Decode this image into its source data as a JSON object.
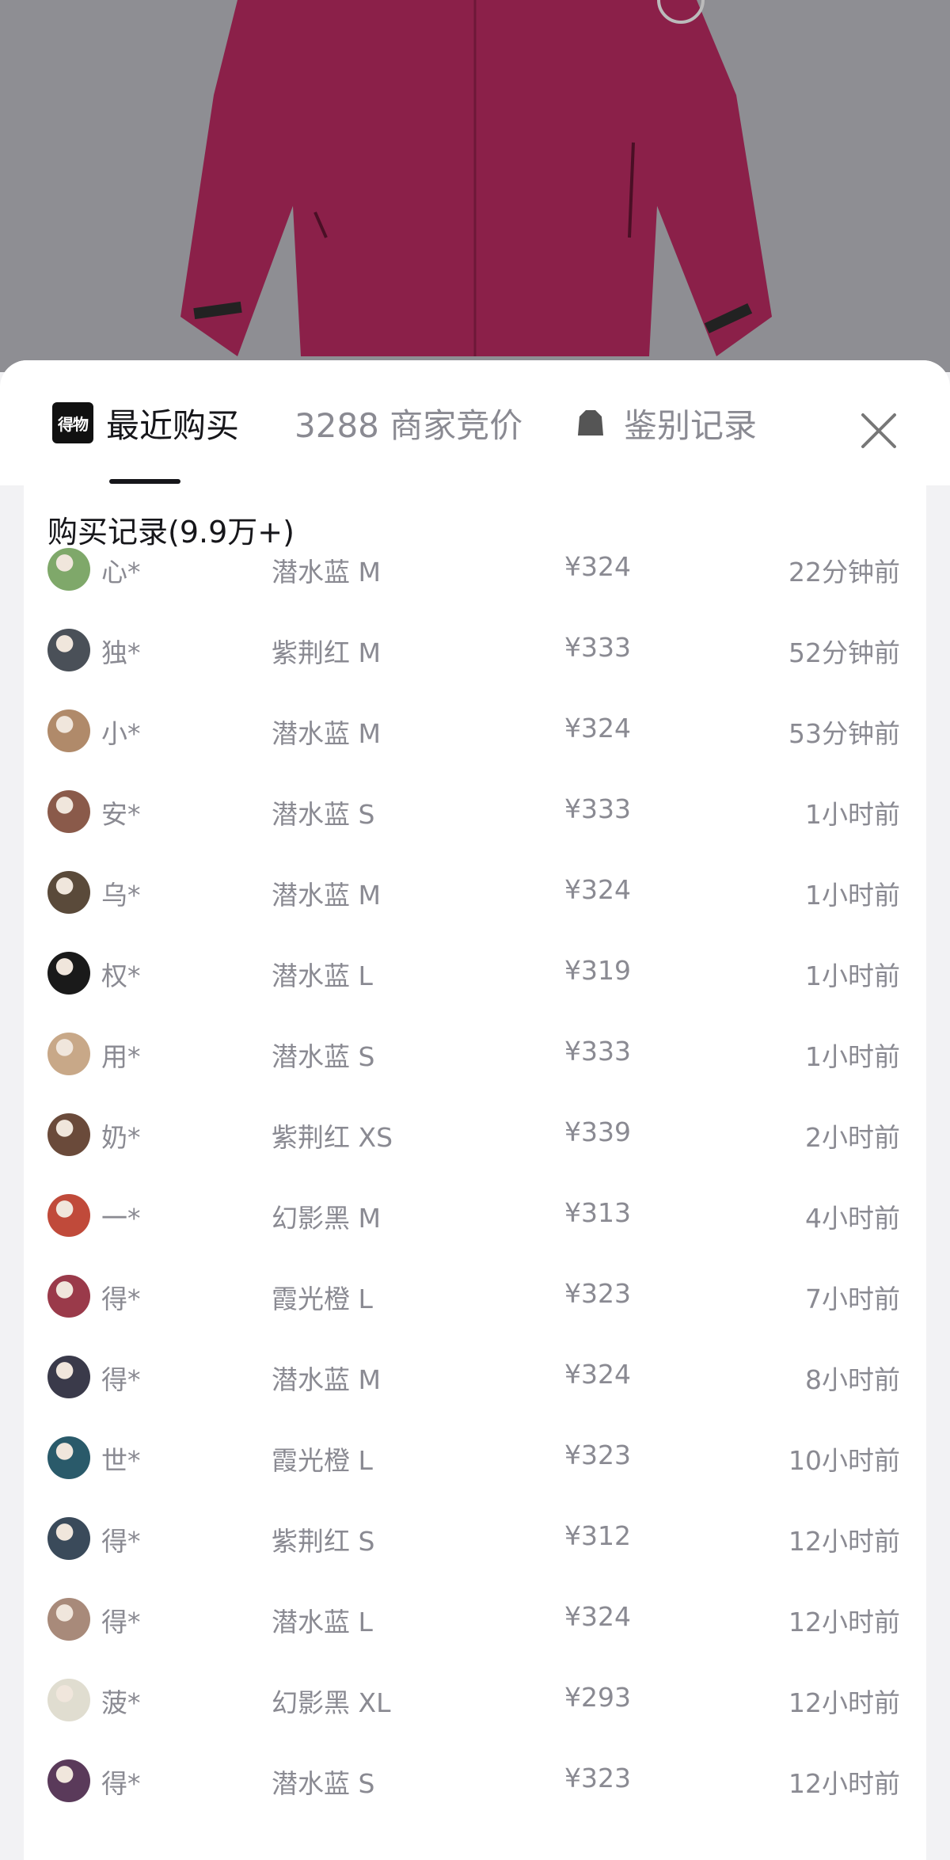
{
  "tabs": {
    "recent_label": "最近购买",
    "bids_label": "3288 商家竞价",
    "auth_label": "鉴别记录",
    "logo_text": "得物"
  },
  "list": {
    "title": "购买记录(9.9万+)",
    "rows": [
      {
        "name": "心*",
        "spec": "潜水蓝 M",
        "price": "¥324",
        "time": "22分钟前",
        "avatar_color": "#7fa86a"
      },
      {
        "name": "独*",
        "spec": "紫荆红 M",
        "price": "¥333",
        "time": "52分钟前",
        "avatar_color": "#4a5058"
      },
      {
        "name": "小*",
        "spec": "潜水蓝 M",
        "price": "¥324",
        "time": "53分钟前",
        "avatar_color": "#b08a6a"
      },
      {
        "name": "安*",
        "spec": "潜水蓝 S",
        "price": "¥333",
        "time": "1小时前",
        "avatar_color": "#8a5a4a"
      },
      {
        "name": "乌*",
        "spec": "潜水蓝 M",
        "price": "¥324",
        "time": "1小时前",
        "avatar_color": "#5a4a3a"
      },
      {
        "name": "权*",
        "spec": "潜水蓝 L",
        "price": "¥319",
        "time": "1小时前",
        "avatar_color": "#1a1a1a"
      },
      {
        "name": "用*",
        "spec": "潜水蓝 S",
        "price": "¥333",
        "time": "1小时前",
        "avatar_color": "#c8a888"
      },
      {
        "name": "奶*",
        "spec": "紫荆红 XS",
        "price": "¥339",
        "time": "2小时前",
        "avatar_color": "#6a4a3a"
      },
      {
        "name": "一*",
        "spec": "幻影黑 M",
        "price": "¥313",
        "time": "4小时前",
        "avatar_color": "#c04a3a"
      },
      {
        "name": "得*",
        "spec": "霞光橙 L",
        "price": "¥323",
        "time": "7小时前",
        "avatar_color": "#9a3a4a"
      },
      {
        "name": "得*",
        "spec": "潜水蓝 M",
        "price": "¥324",
        "time": "8小时前",
        "avatar_color": "#3a3a4a"
      },
      {
        "name": "世*",
        "spec": "霞光橙 L",
        "price": "¥323",
        "time": "10小时前",
        "avatar_color": "#2a5a6a"
      },
      {
        "name": "得*",
        "spec": "紫荆红 S",
        "price": "¥312",
        "time": "12小时前",
        "avatar_color": "#3a4a5a"
      },
      {
        "name": "得*",
        "spec": "潜水蓝 L",
        "price": "¥324",
        "time": "12小时前",
        "avatar_color": "#a88a7a"
      },
      {
        "name": "菠*",
        "spec": "幻影黑 XL",
        "price": "¥293",
        "time": "12小时前",
        "avatar_color": "#e0ddd0"
      },
      {
        "name": "得*",
        "spec": "潜水蓝 S",
        "price": "¥323",
        "time": "12小时前",
        "avatar_color": "#5a3a5a"
      }
    ]
  },
  "colors": {
    "product": "#8b2049",
    "overlay_bg": "#8e8e93"
  }
}
